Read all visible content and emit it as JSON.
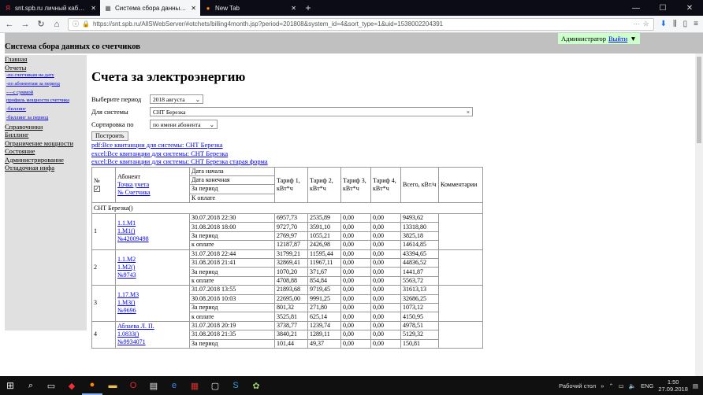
{
  "browser": {
    "tabs": [
      {
        "favicon": "Я",
        "title": "snt.spb.ru личный кабинет — ...",
        "active": false
      },
      {
        "favicon": "▦",
        "title": "Система сбора данных со счетч...",
        "active": true
      },
      {
        "favicon": "●",
        "title": "New Tab",
        "active": false
      }
    ],
    "url": "https://snt.spb.ru/AllSWebServer/#otchets/billing4month.jsp?period=201808&system_id=4&sort_type=1&uid=1538002204391"
  },
  "header": {
    "title": "Система сбора данных со счетчиков",
    "user": "Администратор",
    "logout": "Выйти"
  },
  "sidebar": {
    "items": [
      {
        "label": "Главная",
        "sub": false
      },
      {
        "label": "Отчеты",
        "sub": false
      },
      {
        "label": "-по счетчикам на дату",
        "sub": true
      },
      {
        "label": "-по абонентам за период",
        "sub": true
      },
      {
        "label": "----с суммой",
        "sub": true
      },
      {
        "label": "профиль мощности счетчика",
        "sub": true
      },
      {
        "label": "-биллинг",
        "sub": true
      },
      {
        "label": "-биллинг за период",
        "sub": true
      },
      {
        "label": "Справочники",
        "sub": false
      },
      {
        "label": "Биллинг",
        "sub": false
      },
      {
        "label": "Ограничение мощности",
        "sub": false
      },
      {
        "label": "Состояние",
        "sub": false
      },
      {
        "label": "Администрирование",
        "sub": false
      },
      {
        "label": "Отладочная инфа",
        "sub": false
      }
    ]
  },
  "main": {
    "heading": "Счета за электроэнергию",
    "form": {
      "period_label": "Выберите период",
      "period_value": "2018 августа",
      "system_label": "Для системы",
      "system_value": "СНТ Березка",
      "sort_label": "Сортировка по",
      "sort_value": "по имени абонента",
      "build_button": "Построить"
    },
    "links": [
      "pdf:Все квитанции для системы: СНТ Березка",
      "excel:Все квитанции для системы: СНТ Березка",
      "excel:Все квитанции для системы: СНТ Березка старая форма"
    ]
  },
  "table": {
    "headers": {
      "num": "№",
      "subscriber": "Абонент",
      "account_point": "Точка учета",
      "meter_no": "№ Счетчика",
      "date_start": "Дата начала",
      "date_end": "Дата конечная",
      "period": "За период",
      "to_pay": "К оплате",
      "t1": "Тариф 1, кВт*ч",
      "t2": "Тариф 2, кВт*ч",
      "t3": "Тариф 3, кВт*ч",
      "t4": "Тариф 4, кВт*ч",
      "total": "Всего, кВт/ч",
      "comments": "Комментарии"
    },
    "group": "СНТ Березка()",
    "rows": [
      {
        "num": "1",
        "links": [
          "1.1.М1",
          "1.М1()",
          "№42009498"
        ],
        "lines": [
          [
            "30.07.2018 22:30",
            "6957,73",
            "2535,89",
            "0,00",
            "0,00",
            "9493,62"
          ],
          [
            "31.08.2018 18:00",
            "9727,70",
            "3591,10",
            "0,00",
            "0,00",
            "13318,80"
          ],
          [
            "За период",
            "2769,97",
            "1055,21",
            "0,00",
            "0,00",
            "3825,18"
          ],
          [
            "к оплате",
            "12187,87",
            "2426,98",
            "0,00",
            "0,00",
            "14614,85"
          ]
        ]
      },
      {
        "num": "2",
        "links": [
          "1.1.М2",
          "1.М2()",
          "№9743"
        ],
        "lines": [
          [
            "31.07.2018 22:44",
            "31799,21",
            "11595,44",
            "0,00",
            "0,00",
            "43394,65"
          ],
          [
            "31.08.2018 21:41",
            "32869,41",
            "11967,11",
            "0,00",
            "0,00",
            "44836,52"
          ],
          [
            "За период",
            "1070,20",
            "371,67",
            "0,00",
            "0,00",
            "1441,87"
          ],
          [
            "к оплате",
            "4708,88",
            "854,84",
            "0,00",
            "0,00",
            "5563,72"
          ]
        ]
      },
      {
        "num": "3",
        "links": [
          "1.17.М3",
          "1.М3()",
          "№9696"
        ],
        "lines": [
          [
            "31.07.2018 13:55",
            "21893,68",
            "9719,45",
            "0,00",
            "0,00",
            "31613,13"
          ],
          [
            "30.08.2018 10:03",
            "22695,00",
            "9991,25",
            "0,00",
            "0,00",
            "32686,25"
          ],
          [
            "За период",
            "801,32",
            "271,80",
            "0,00",
            "0,00",
            "1073,12"
          ],
          [
            "к оплате",
            "3525,81",
            "625,14",
            "0,00",
            "0,00",
            "4150,95"
          ]
        ]
      },
      {
        "num": "4",
        "links": [
          "Аблаева Л. П.",
          "1.0833()",
          "№9934071"
        ],
        "lines": [
          [
            "31.07.2018 20:19",
            "3738,77",
            "1239,74",
            "0,00",
            "0,00",
            "4978,51"
          ],
          [
            "31.08.2018 21:35",
            "3840,21",
            "1289,11",
            "0,00",
            "0,00",
            "5129,32"
          ],
          [
            "За период",
            "101,44",
            "49,37",
            "0,00",
            "0,00",
            "150,81"
          ]
        ]
      }
    ]
  },
  "taskbar": {
    "lang": "ENG",
    "desktop": "Рабочий стол",
    "time": "1:50",
    "date": "27.09.2018"
  }
}
